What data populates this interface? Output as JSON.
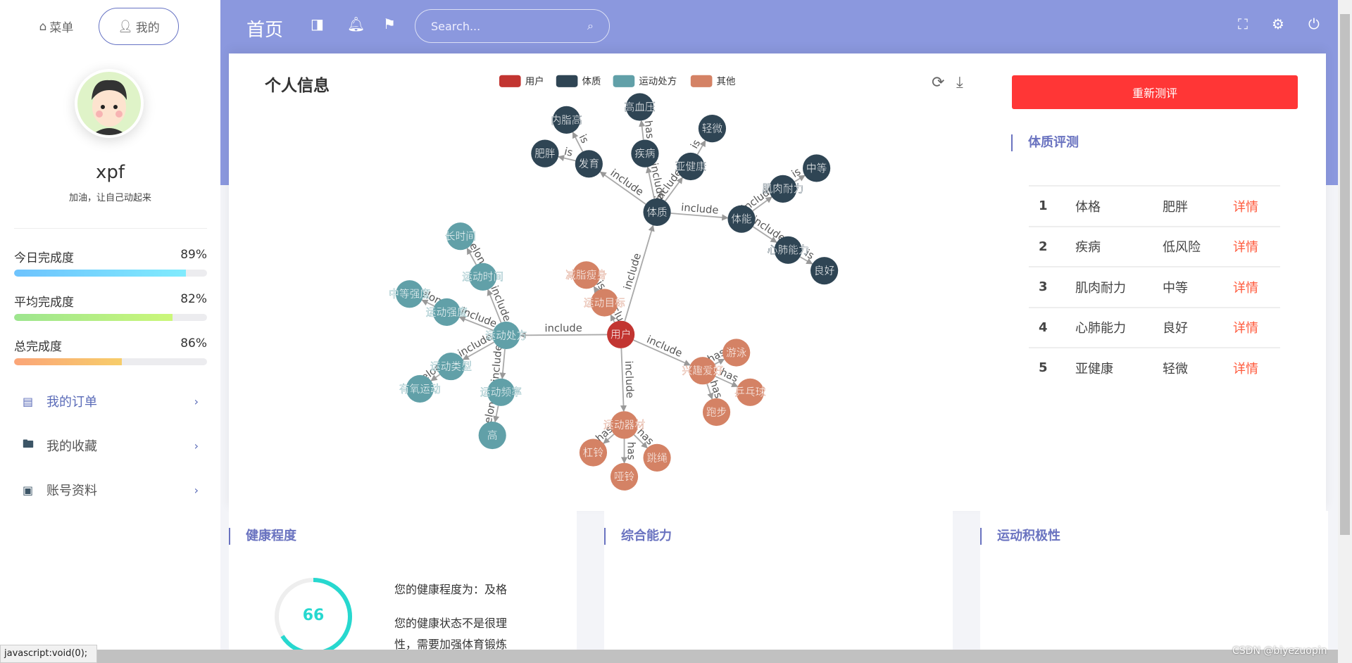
{
  "sidebar": {
    "tabs": [
      {
        "label": "菜单",
        "icon": "home-icon"
      },
      {
        "label": "我的",
        "icon": "user-icon"
      }
    ],
    "username": "xpf",
    "motto": "加油，让自己动起来",
    "progress": [
      {
        "label": "今日完成度",
        "value_text": "89%",
        "fill": 0.89,
        "colors": [
          "#6ec3fd",
          "#80ebfd"
        ]
      },
      {
        "label": "平均完成度",
        "value_text": "82%",
        "fill": 0.82,
        "colors": [
          "#9de58f",
          "#cbf77a"
        ]
      },
      {
        "label": "总完成度",
        "value_text": "86%",
        "fill": 0.56,
        "colors": [
          "#fba578",
          "#f7cd6a"
        ]
      }
    ],
    "menu": [
      {
        "label": "我的订单",
        "icon": "order-icon",
        "active": true
      },
      {
        "label": "我的收藏",
        "icon": "favorite-folder-icon"
      },
      {
        "label": "账号资料",
        "icon": "account-icon"
      }
    ]
  },
  "header": {
    "title": "首页",
    "search_placeholder": "Search...",
    "color": "#8b98de"
  },
  "graph": {
    "title": "个人信息",
    "legend": [
      {
        "name": "用户",
        "color": "#c23531"
      },
      {
        "name": "体质",
        "color": "#2f4554"
      },
      {
        "name": "运动处方",
        "color": "#61a0a8"
      },
      {
        "name": "其他",
        "color": "#d48265"
      }
    ],
    "nodes": [
      {
        "name": "用户",
        "cat": 0
      },
      {
        "name": "体质",
        "cat": 1
      },
      {
        "name": "体能",
        "cat": 1
      },
      {
        "name": "发育",
        "cat": 1
      },
      {
        "name": "肥胖",
        "cat": 1
      },
      {
        "name": "内脂高",
        "cat": 1
      },
      {
        "name": "疾病",
        "cat": 1
      },
      {
        "name": "高血压",
        "cat": 1
      },
      {
        "name": "亚健康",
        "cat": 1
      },
      {
        "name": "轻微",
        "cat": 1
      },
      {
        "name": "肌肉耐力",
        "cat": 1
      },
      {
        "name": "中等",
        "cat": 1
      },
      {
        "name": "心肺能力",
        "cat": 1
      },
      {
        "name": "良好",
        "cat": 1
      },
      {
        "name": "运动处方",
        "cat": 2
      },
      {
        "name": "运动时间",
        "cat": 2
      },
      {
        "name": "长时间",
        "cat": 2
      },
      {
        "name": "运动强度",
        "cat": 2
      },
      {
        "name": "中等强度",
        "cat": 2
      },
      {
        "name": "运动类型",
        "cat": 2
      },
      {
        "name": "有氧运动",
        "cat": 2
      },
      {
        "name": "运动频率",
        "cat": 2
      },
      {
        "name": "高",
        "cat": 2
      },
      {
        "name": "运动目标",
        "cat": 3
      },
      {
        "name": "减脂瘦身",
        "cat": 3
      },
      {
        "name": "兴趣爱好",
        "cat": 3
      },
      {
        "name": "游泳",
        "cat": 3
      },
      {
        "name": "乒乓球",
        "cat": 3
      },
      {
        "name": "跑步",
        "cat": 3
      },
      {
        "name": "运动器材",
        "cat": 3
      },
      {
        "name": "杠铃",
        "cat": 3
      },
      {
        "name": "哑铃",
        "cat": 3
      },
      {
        "name": "跳绳",
        "cat": 3
      }
    ],
    "edges": [
      [
        "用户",
        "体质",
        "include"
      ],
      [
        "用户",
        "运动处方",
        "include"
      ],
      [
        "用户",
        "运动目标",
        "include"
      ],
      [
        "用户",
        "兴趣爱好",
        "include"
      ],
      [
        "用户",
        "运动器材",
        "include"
      ],
      [
        "体质",
        "发育",
        "include"
      ],
      [
        "体质",
        "疾病",
        "include"
      ],
      [
        "体质",
        "亚健康",
        "include"
      ],
      [
        "体质",
        "体能",
        "include"
      ],
      [
        "发育",
        "肥胖",
        "is"
      ],
      [
        "发育",
        "内脂高",
        "is"
      ],
      [
        "疾病",
        "高血压",
        "has"
      ],
      [
        "亚健康",
        "轻微",
        "is"
      ],
      [
        "体能",
        "肌肉耐力",
        "include"
      ],
      [
        "体能",
        "心肺能力",
        "include"
      ],
      [
        "肌肉耐力",
        "中等",
        "is"
      ],
      [
        "心肺能力",
        "良好",
        "is"
      ],
      [
        "运动处方",
        "运动时间",
        "include"
      ],
      [
        "运动处方",
        "运动强度",
        "include"
      ],
      [
        "运动处方",
        "运动类型",
        "include"
      ],
      [
        "运动处方",
        "运动频率",
        "include"
      ],
      [
        "运动时间",
        "长时间",
        "belong"
      ],
      [
        "运动强度",
        "中等强度",
        "belong"
      ],
      [
        "运动类型",
        "有氧运动",
        "belong"
      ],
      [
        "运动频率",
        "高",
        "belong"
      ],
      [
        "运动目标",
        "减脂瘦身",
        "is"
      ],
      [
        "兴趣爱好",
        "游泳",
        "has"
      ],
      [
        "兴趣爱好",
        "乒乓球",
        "has"
      ],
      [
        "兴趣爱好",
        "跑步",
        "has"
      ],
      [
        "运动器材",
        "杠铃",
        "has"
      ],
      [
        "运动器材",
        "哑铃",
        "has"
      ],
      [
        "运动器材",
        "跳绳",
        "has"
      ]
    ]
  },
  "assessment": {
    "button": "重新测评",
    "title": "体质评测",
    "link_label": "详情",
    "rows": [
      {
        "no": "1",
        "item": "体格",
        "result": "肥胖"
      },
      {
        "no": "2",
        "item": "疾病",
        "result": "低风险"
      },
      {
        "no": "3",
        "item": "肌肉耐力",
        "result": "中等"
      },
      {
        "no": "4",
        "item": "心肺能力",
        "result": "良好"
      },
      {
        "no": "5",
        "item": "亚健康",
        "result": "轻微"
      }
    ]
  },
  "panels": {
    "health": {
      "title": "健康程度",
      "score": "66",
      "score_fraction": 0.66,
      "line1": "您的健康程度为：及格",
      "line2": "您的健康状态不是很理",
      "line3": "性，需要加强体育锻炼"
    },
    "ability": {
      "title": "综合能力"
    },
    "activity": {
      "title": "运动积极性"
    }
  },
  "status_bar": "javascript:void(0);",
  "watermark": "CSDN @biyezuopin"
}
